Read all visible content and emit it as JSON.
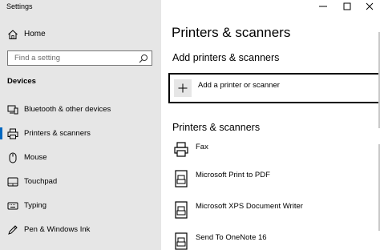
{
  "window": {
    "title": "Settings"
  },
  "sidebar": {
    "home_label": "Home",
    "search_placeholder": "Find a setting",
    "section": "Devices",
    "items": [
      {
        "label": "Bluetooth & other devices",
        "icon": "bluetooth-devices-icon",
        "selected": false
      },
      {
        "label": "Printers & scanners",
        "icon": "printer-icon",
        "selected": true
      },
      {
        "label": "Mouse",
        "icon": "mouse-icon",
        "selected": false
      },
      {
        "label": "Touchpad",
        "icon": "touchpad-icon",
        "selected": false
      },
      {
        "label": "Typing",
        "icon": "keyboard-icon",
        "selected": false
      },
      {
        "label": "Pen & Windows Ink",
        "icon": "pen-icon",
        "selected": false
      }
    ]
  },
  "main": {
    "title": "Printers & scanners",
    "add_section_title": "Add printers & scanners",
    "add_button_label": "Add a printer or scanner",
    "list_title": "Printers & scanners",
    "printers": [
      {
        "name": "Fax",
        "icon": "fax-icon"
      },
      {
        "name": "Microsoft Print to PDF",
        "icon": "printer-icon"
      },
      {
        "name": "Microsoft XPS Document Writer",
        "icon": "printer-icon"
      },
      {
        "name": "Send To OneNote 16",
        "icon": "printer-icon"
      }
    ]
  },
  "colors": {
    "sidebar_bg": "#e6e6e6",
    "accent": "#0067c0"
  }
}
